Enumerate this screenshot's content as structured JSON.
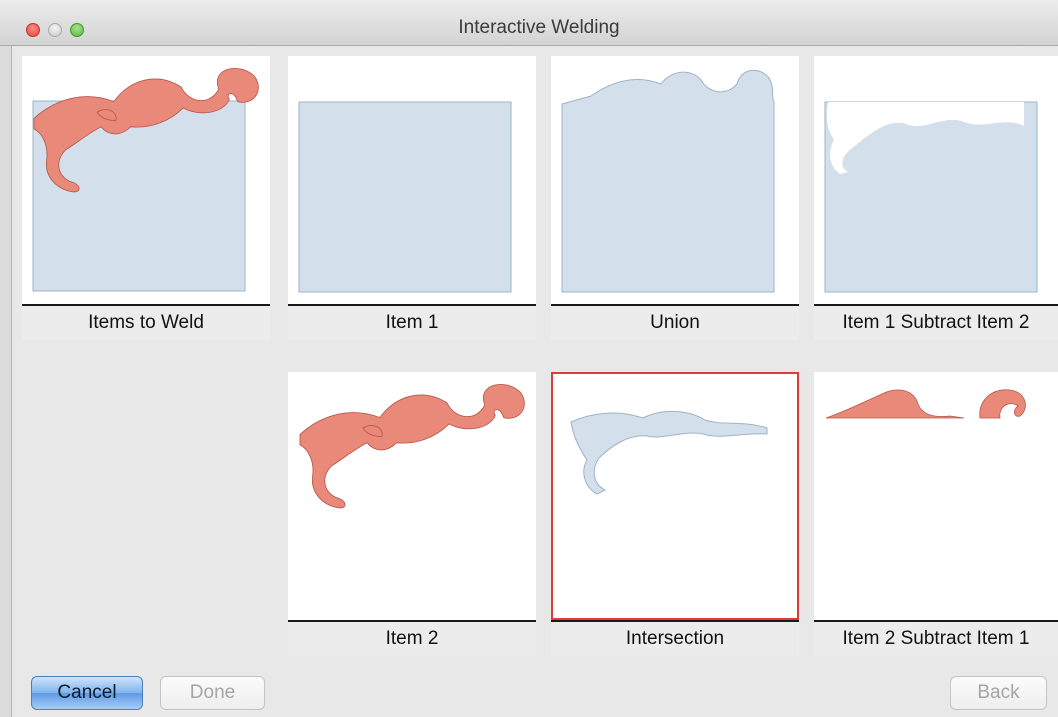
{
  "window": {
    "title": "Interactive Welding"
  },
  "colors": {
    "shape_fill": "#d3e0eb",
    "ornament_fill": "#e8897a",
    "selection_border": "#e03a3a"
  },
  "tiles": [
    {
      "caption": "Items to Weld"
    },
    {
      "caption": "Item 1"
    },
    {
      "caption": "Union"
    },
    {
      "caption": "Item 1 Subtract Item 2"
    },
    {
      "caption": "Item 2"
    },
    {
      "caption": "Intersection"
    },
    {
      "caption": "Item 2 Subtract Item 1"
    }
  ],
  "selected_tile": "Intersection",
  "buttons": {
    "cancel": "Cancel",
    "done": "Done",
    "back": "Back"
  }
}
